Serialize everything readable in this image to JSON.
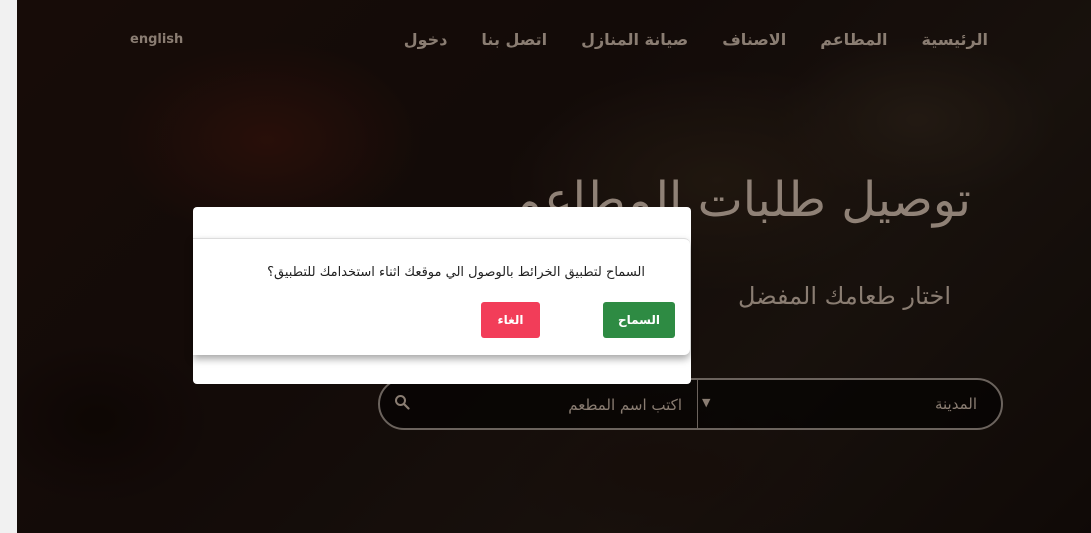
{
  "nav": {
    "items": [
      "الرئيسية",
      "المطاعم",
      "الاصناف",
      "صيانة المنازل",
      "اتصل بنا",
      "دخول"
    ],
    "language": "english"
  },
  "hero": {
    "title": "توصيل طلبات المطاعم",
    "subtitle": "اختار طعامك المفضل"
  },
  "search": {
    "city": "المدينة",
    "restaurant_placeholder": "اكتب اسم المطعم",
    "icon": "search-icon",
    "dropdown_icon": "caret-down-icon"
  },
  "dialog": {
    "message": "السماح لتطبيق الخرائط بالوصول الي موقعك اثناء استخدامك للتطبيق؟",
    "allow_label": "السماح",
    "cancel_label": "الغاء"
  },
  "colors": {
    "allow": "#2e8b43",
    "cancel": "#f23d59"
  }
}
